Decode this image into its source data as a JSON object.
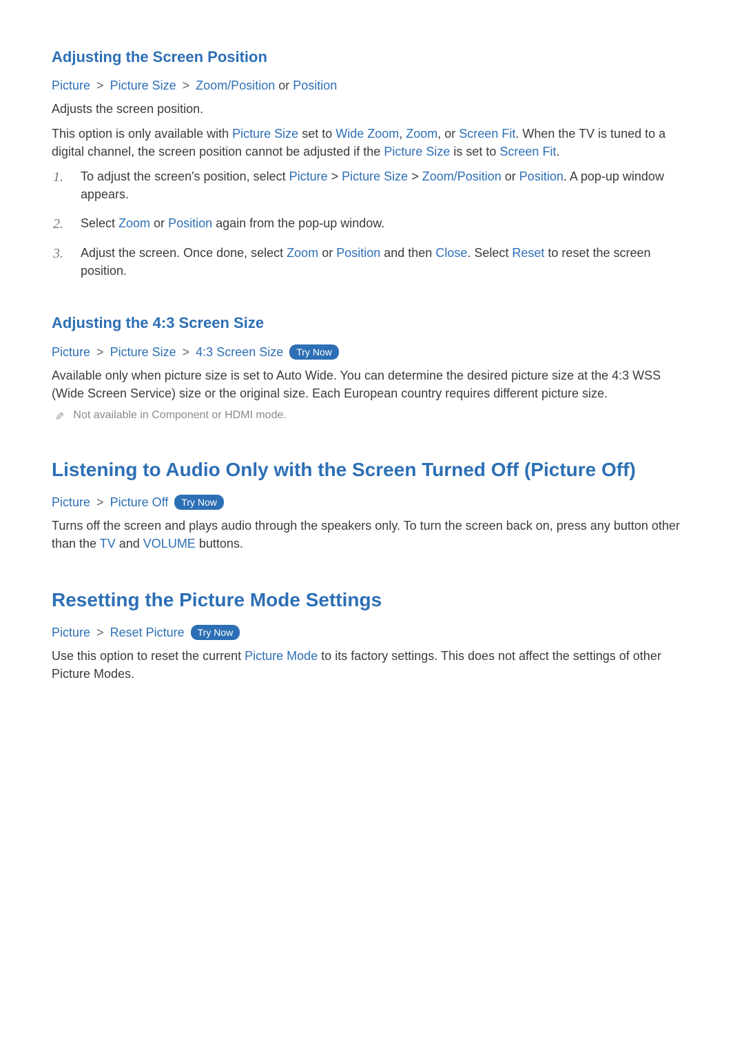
{
  "trynow_label": "Try Now",
  "sect1": {
    "heading": "Adjusting the Screen Position",
    "bc": {
      "a": "Picture",
      "b": "Picture Size",
      "c": "Zoom/Position",
      "or": "or",
      "d": "Position"
    },
    "p1": "Adjusts the screen position.",
    "p2_a": "This option is only available with ",
    "p2_b": "Picture Size",
    "p2_c": " set to ",
    "p2_d": "Wide Zoom",
    "p2_e": ", ",
    "p2_f": "Zoom",
    "p2_g": ", or ",
    "p2_h": "Screen Fit",
    "p2_i": ". When the TV is tuned to a digital channel, the screen position cannot be adjusted if the ",
    "p2_j": "Picture Size",
    "p2_k": " is set to ",
    "p2_l": "Screen Fit",
    "p2_m": ".",
    "li1": {
      "n": "1.",
      "a": "To adjust the screen's position, select ",
      "b": "Picture",
      "c": "Picture Size",
      "d": "Zoom/Position",
      "or": " or ",
      "e": "Position",
      "f": ". A pop-up window appears."
    },
    "li2": {
      "n": "2.",
      "a": "Select ",
      "b": "Zoom",
      "c": " or ",
      "d": "Position",
      "e": " again from the pop-up window."
    },
    "li3": {
      "n": "3.",
      "a": "Adjust the screen. Once done, select ",
      "b": "Zoom",
      "c": " or ",
      "d": "Position",
      "e": " and then ",
      "f": "Close",
      "g": ". Select ",
      "h": "Reset",
      "i": " to reset the screen position."
    }
  },
  "sect2": {
    "heading": "Adjusting the 4:3 Screen Size",
    "bc": {
      "a": "Picture",
      "b": "Picture Size",
      "c": "4:3 Screen Size"
    },
    "p1": "Available only when picture size is set to Auto Wide. You can determine the desired picture size at the 4:3 WSS (Wide Screen Service) size or the original size. Each European country requires different picture size.",
    "note": "Not available in Component or HDMI mode."
  },
  "sect3": {
    "heading": "Listening to Audio Only with the Screen Turned Off (Picture Off)",
    "bc": {
      "a": "Picture",
      "b": "Picture Off"
    },
    "p1_a": "Turns off the screen and plays audio through the speakers only. To turn the screen back on, press any button other than the ",
    "p1_b": "TV",
    "p1_c": " and ",
    "p1_d": "VOLUME",
    "p1_e": " buttons."
  },
  "sect4": {
    "heading": "Resetting the Picture Mode Settings",
    "bc": {
      "a": "Picture",
      "b": "Reset Picture"
    },
    "p1_a": "Use this option to reset the current ",
    "p1_b": "Picture Mode",
    "p1_c": " to its factory settings. This does not affect the settings of other Picture Modes."
  }
}
